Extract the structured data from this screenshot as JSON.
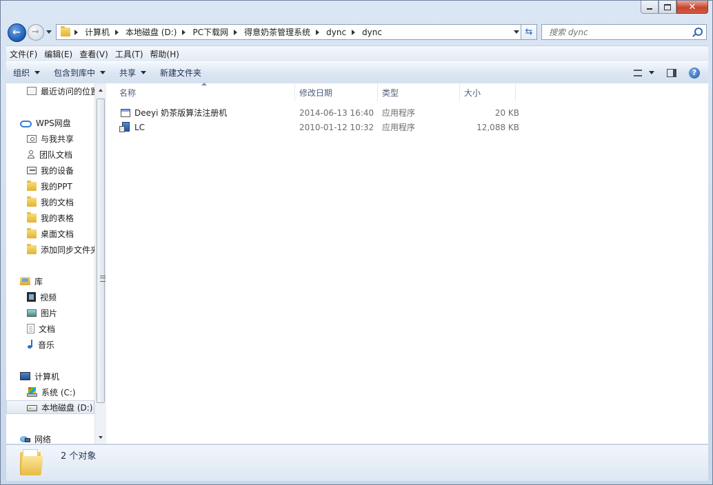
{
  "window": {
    "path": [
      "计算机",
      "本地磁盘 (D:)",
      "PC下载网",
      "得意奶茶管理系统",
      "dync",
      "dync"
    ],
    "search_placeholder": "搜索 dync"
  },
  "menu": [
    "文件(F)",
    "编辑(E)",
    "查看(V)",
    "工具(T)",
    "帮助(H)"
  ],
  "toolbar": {
    "organize": "组织",
    "include_library": "包含到库中",
    "share": "共享",
    "new_folder": "新建文件夹"
  },
  "sidebar": {
    "recent": "最近访问的位置",
    "wps": "WPS网盘",
    "wps_items": [
      "与我共享",
      "团队文档",
      "我的设备",
      "我的PPT",
      "我的文档",
      "我的表格",
      "桌面文档",
      "添加同步文件夹"
    ],
    "library": "库",
    "library_items": [
      "视频",
      "图片",
      "文档",
      "音乐"
    ],
    "computer": "计算机",
    "computer_items": [
      "系统 (C:)",
      "本地磁盘 (D:)"
    ],
    "network": "网络"
  },
  "columns": [
    "名称",
    "修改日期",
    "类型",
    "大小"
  ],
  "files": [
    {
      "name": "Deeyi 奶茶版算法注册机",
      "modified": "2014-06-13 16:40",
      "type": "应用程序",
      "size": "20 KB",
      "icon": "exe-icon"
    },
    {
      "name": "LC",
      "modified": "2010-01-12 10:32",
      "type": "应用程序",
      "size": "12,088 KB",
      "icon": "setup-icon"
    }
  ],
  "status": {
    "count": "2 个对象"
  }
}
